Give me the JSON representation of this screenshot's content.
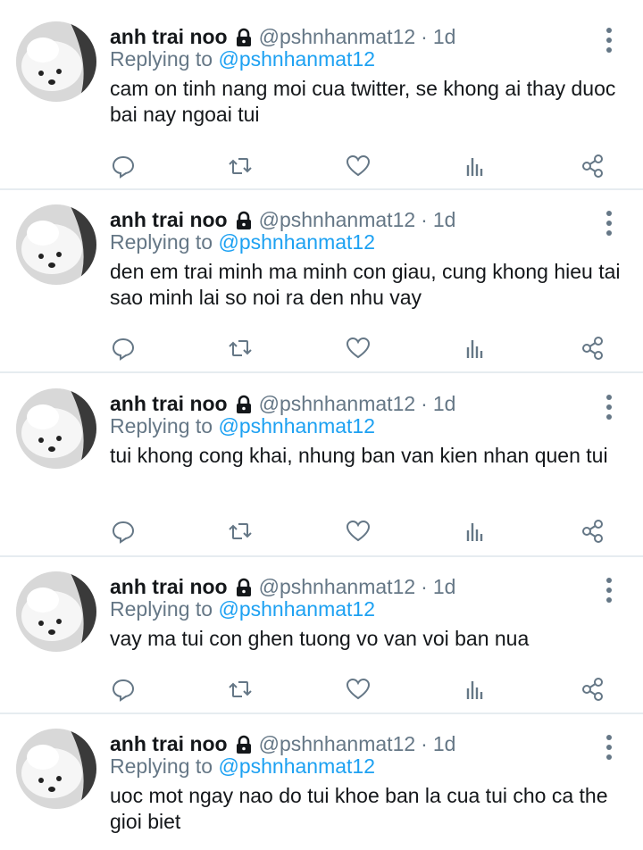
{
  "colors": {
    "muted": "#657786",
    "link": "#1da1f2",
    "text": "#14171a",
    "divider": "#e6ecf0"
  },
  "tweets": [
    {
      "name": "anh trai noo",
      "handle": "@pshnhanmat12",
      "separator": "·",
      "time": "1d",
      "replying_label": "Replying to",
      "replying_to": "@pshnhanmat12",
      "text": "cam on tinh nang moi cua twitter, se khong ai thay duoc bai nay ngoai tui"
    },
    {
      "name": "anh trai noo",
      "handle": "@pshnhanmat12",
      "separator": "·",
      "time": "1d",
      "replying_label": "Replying to",
      "replying_to": "@pshnhanmat12",
      "text": "den em trai minh ma minh con giau, cung khong hieu tai sao minh lai so noi ra den nhu vay"
    },
    {
      "name": "anh trai noo",
      "handle": "@pshnhanmat12",
      "separator": "·",
      "time": "1d",
      "replying_label": "Replying to",
      "replying_to": "@pshnhanmat12",
      "text": "tui khong cong khai, nhung ban van kien nhan quen tui"
    },
    {
      "name": "anh trai noo",
      "handle": "@pshnhanmat12",
      "separator": "·",
      "time": "1d",
      "replying_label": "Replying to",
      "replying_to": "@pshnhanmat12",
      "text": "vay ma tui con ghen tuong vo van voi ban nua"
    },
    {
      "name": "anh trai noo",
      "handle": "@pshnhanmat12",
      "separator": "·",
      "time": "1d",
      "replying_label": "Replying to",
      "replying_to": "@pshnhanmat12",
      "text": "uoc mot ngay nao do tui khoe ban la cua tui cho ca the gioi biet"
    }
  ],
  "icons": {
    "lock": "lock-icon",
    "more": "more-vertical-icon",
    "reply": "reply-icon",
    "retweet": "retweet-icon",
    "like": "heart-icon",
    "analytics": "analytics-icon",
    "share": "share-icon"
  }
}
